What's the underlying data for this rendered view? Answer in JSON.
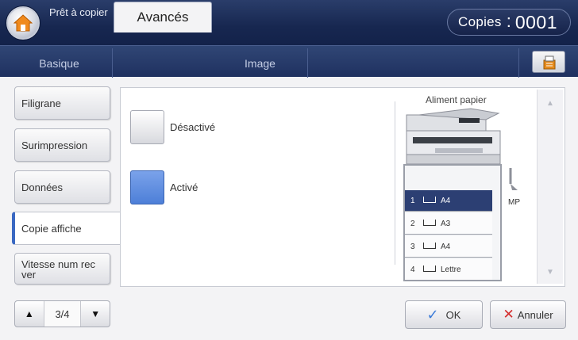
{
  "header": {
    "status": "Prêt à copier",
    "copies_label": "Copies",
    "copies_separator": ":",
    "copies_value": "0001"
  },
  "tabs": {
    "basic": "Basique",
    "advanced": "Avancés",
    "image": "Image"
  },
  "sidebar": {
    "items": [
      "Filigrane",
      "Surimpression",
      "Données",
      "Copie affiche",
      "Vitesse num rec ver"
    ],
    "selected_index": 3
  },
  "options": {
    "off_label": "Désactivé",
    "on_label": "Activé",
    "selected": "on"
  },
  "paper": {
    "title": "Aliment papier",
    "trays": [
      {
        "num": "1",
        "size": "A4"
      },
      {
        "num": "2",
        "size": "A3"
      },
      {
        "num": "3",
        "size": "A4"
      },
      {
        "num": "4",
        "size": "Lettre"
      }
    ],
    "selected_tray": 0,
    "mp_label": "MP"
  },
  "pager": {
    "page": "3/4"
  },
  "footer": {
    "ok_label": "OK",
    "cancel_label": "Annuler"
  },
  "colors": {
    "header_bg": "#172750",
    "accent_blue": "#4d7fd8",
    "selected_tray": "#2c3f73",
    "cancel_icon": "#d32a2a"
  }
}
